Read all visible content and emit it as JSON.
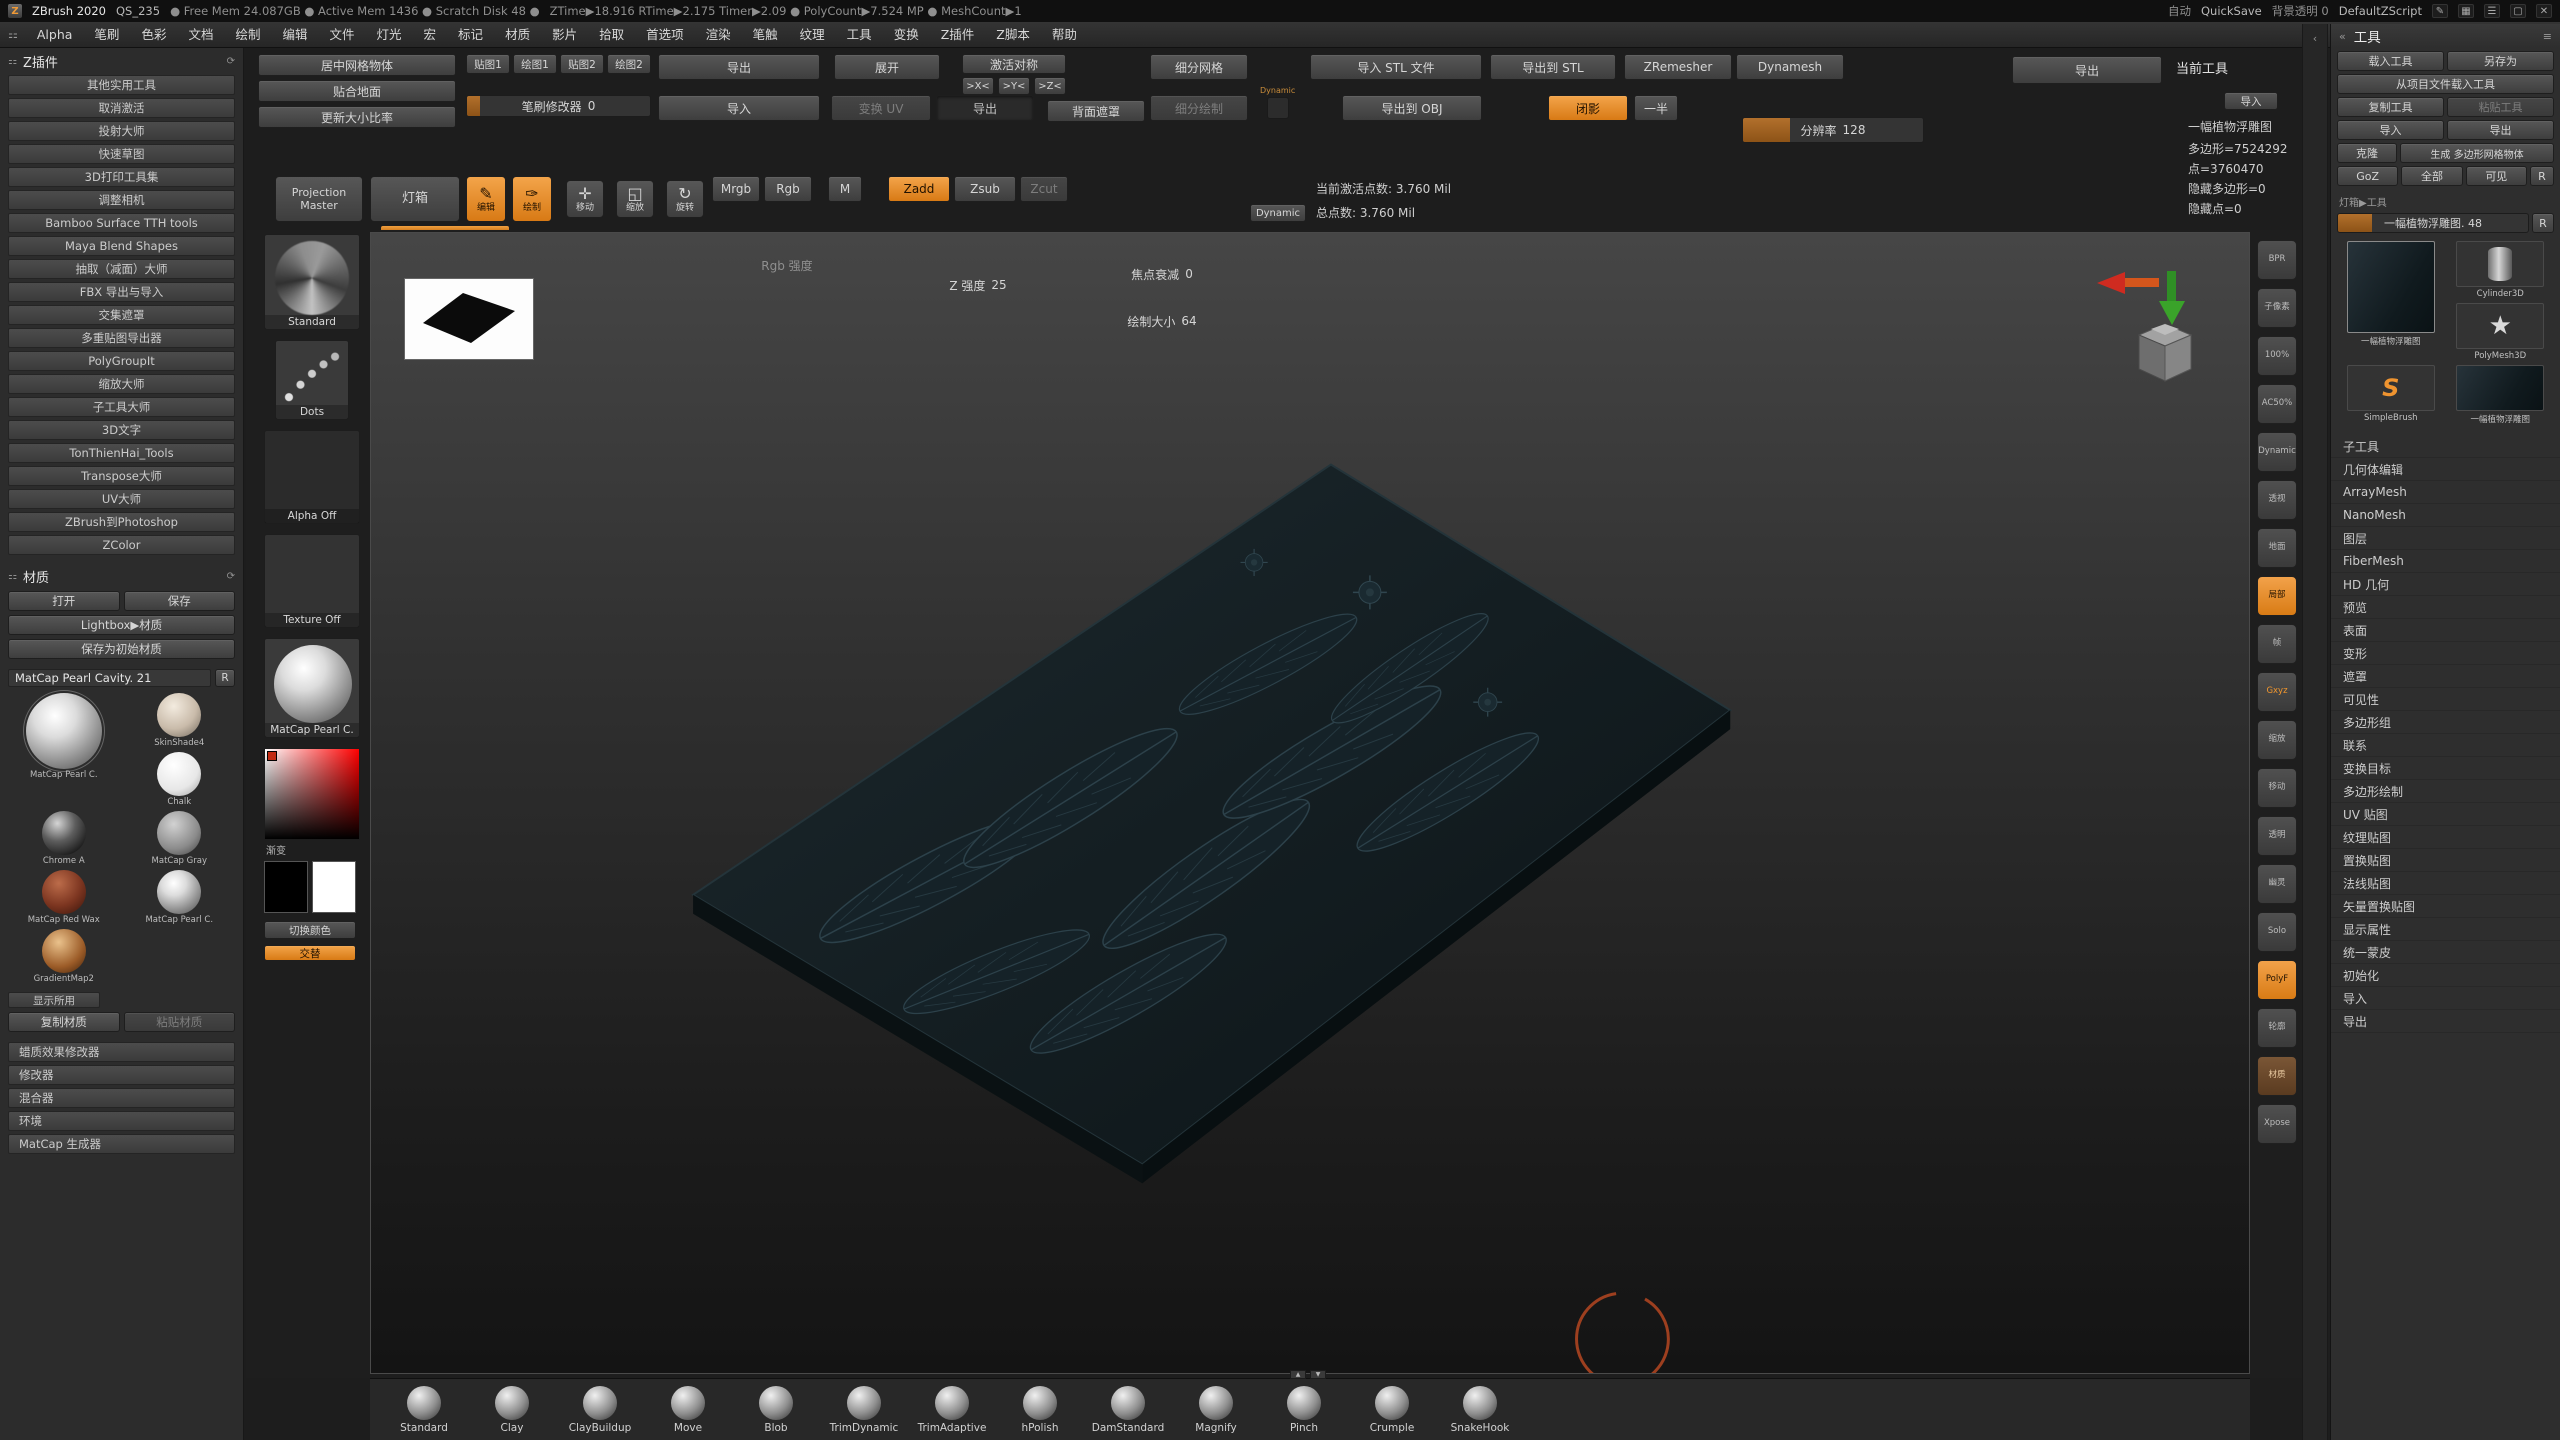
{
  "titlebar": {
    "logo": "Z",
    "app": "ZBrush 2020",
    "doc": "QS_235",
    "mem": "● Free Mem 24.087GB ● Active Mem 1436 ● Scratch Disk 48 ●",
    "time": "ZTime▶18.916 RTime▶2.175 Timer▶2.09 ● PolyCount▶7.524 MP ● MeshCount▶1",
    "auto": "自动",
    "quicksave": "QuickSave",
    "bg": "背景透明 0",
    "zscript": "DefaultZScript",
    "icons": {
      "pencil": "✎",
      "grid": "▦",
      "list": "☰",
      "window": "▢",
      "close": "✕"
    }
  },
  "menubar": {
    "left_icon": "⚏",
    "collapse": "«",
    "items": [
      "Alpha",
      "笔刷",
      "色彩",
      "文档",
      "绘制",
      "编辑",
      "文件",
      "灯光",
      "宏",
      "标记",
      "材质",
      "影片",
      "拾取",
      "首选项",
      "渲染",
      "笔触",
      "纹理",
      "工具",
      "变换",
      "Z插件",
      "Z脚本",
      "帮助"
    ]
  },
  "shelf": {
    "center_mesh": "居中网格物体",
    "snap_ground": "贴合地面",
    "update_ratio": "更新大小比率",
    "tex1": "贴图1",
    "paint1": "绘图1",
    "tex2": "贴图2",
    "paint2": "绘图2",
    "brush_mod": "笔刷修改器",
    "brush_mod_val": "0",
    "export1": "导出",
    "import1": "导入",
    "unwrap": "展开",
    "morph_uv": "变换 UV",
    "export2": "导出",
    "sym_active": "激活对称",
    "sx": ">X<",
    "sy": ">Y<",
    "sz": ">Z<",
    "backface": "背面遮罩",
    "divide": "细分网格",
    "divide_paint": "细分绘制",
    "dynamic_chip": "Dynamic",
    "import_stl": "导入 STL 文件",
    "export_obj": "导出到 OBJ",
    "export_stl": "导出到 STL",
    "shadow": "闭影",
    "half": "一半",
    "zremesher": "ZRemesher",
    "dynamesh": "Dynamesh",
    "resolution": "分辨率",
    "resolution_val": "128",
    "export_right": "导出",
    "current_tool": "当前工具",
    "import_small": "导入",
    "stats": {
      "name": "一幅植物浮雕图",
      "polys": "多边形=7524292",
      "points": "点=3760470",
      "hidden_polys": "隐藏多边形=0",
      "hidden_points": "隐藏点=0"
    }
  },
  "toolbar": {
    "projection_master_1": "Projection",
    "projection_master_2": "Master",
    "lightbox": "灯箱",
    "edit": "编辑",
    "draw": "绘制",
    "move": "移动",
    "scale": "缩放",
    "rotate": "旋转",
    "mrgb": "Mrgb",
    "rgb": "Rgb",
    "m": "M",
    "zadd": "Zadd",
    "zsub": "Zsub",
    "zcut": "Zcut",
    "rgb_intensity": "Rgb 强度",
    "z_intensity": "Z 强度",
    "z_intensity_val": "25",
    "focal": "焦点衰减",
    "focal_val": "0",
    "draw_size": "绘制大小",
    "draw_size_val": "64",
    "dynamic": "Dynamic",
    "active_points": "当前激活点数: 3.760 Mil",
    "total_points": "总点数: 3.760 Mil"
  },
  "zplugin": {
    "title": "Z插件",
    "refresh": "⟳",
    "items": [
      "其他实用工具",
      "取消激活",
      "投射大师",
      "快速草图",
      "3D打印工具集",
      "调整相机",
      "Bamboo Surface TTH tools",
      "Maya Blend Shapes",
      "抽取（减面）大师",
      "FBX 导出与导入",
      "交集遮罩",
      "多重贴图导出器",
      "PolyGroupIt",
      "缩放大师",
      "子工具大师",
      "3D文字",
      "TonThienHai_Tools",
      "Transpose大师",
      "UV大师",
      "ZBrush到Photoshop",
      "ZColor"
    ]
  },
  "material": {
    "title": "材质",
    "refresh": "⟳",
    "open": "打开",
    "save": "保存",
    "lightbox_mat": "Lightbox▶材质",
    "save_startup": "保存为初始材质",
    "current": "MatCap Pearl Cavity. 21",
    "r": "R",
    "spheres": [
      {
        "name": "MatCap Pearl C.",
        "cls": "sph-pearl",
        "cell": "big"
      },
      {
        "name": "SkinShade4",
        "cls": "sph-skin",
        "cell": ""
      },
      {
        "name": "Chalk",
        "cls": "sph-chalk",
        "cell": ""
      },
      {
        "name": "Chrome A",
        "cls": "sph-chrome",
        "cell": ""
      },
      {
        "name": "MatCap Gray",
        "cls": "sph-gray",
        "cell": ""
      },
      {
        "name": "MatCap Red Wax",
        "cls": "sph-redwax",
        "cell": ""
      },
      {
        "name": "MatCap Pearl C.",
        "cls": "sph-pearl",
        "cell": ""
      },
      {
        "name": "GradientMap2",
        "cls": "sph-gradient",
        "cell": ""
      }
    ],
    "show_used": "显示所用",
    "copy": "复制材质",
    "paste": "粘贴材质",
    "sections": [
      "蜡质效果修改器",
      "修改器",
      "混合器",
      "环境",
      "MatCap 生成器"
    ]
  },
  "strip": {
    "brush_label": "Standard",
    "stroke_label": "Dots",
    "alpha_label": "Alpha Off",
    "texture_label": "Texture Off",
    "material_label": "MatCap Pearl C.",
    "gradient_label": "渐变",
    "switch_color": "切换颜色",
    "swap": "交替"
  },
  "rightshelf": [
    {
      "label": "BPR",
      "cls": ""
    },
    {
      "label": "子像素",
      "cls": ""
    },
    {
      "label": "100%",
      "cls": ""
    },
    {
      "label": "AC50%",
      "cls": ""
    },
    {
      "label": "Dynamic",
      "cls": ""
    },
    {
      "label": "透视",
      "cls": ""
    },
    {
      "label": "地面",
      "cls": ""
    },
    {
      "label": "局部",
      "cls": "on"
    },
    {
      "label": "帧",
      "cls": ""
    },
    {
      "label": "Gxyz",
      "cls": "txt-on"
    },
    {
      "label": "缩放",
      "cls": ""
    },
    {
      "label": "移动",
      "cls": ""
    },
    {
      "label": "透明",
      "cls": ""
    },
    {
      "label": "幽灵",
      "cls": ""
    },
    {
      "label": "Solo",
      "cls": ""
    },
    {
      "label": "PolyF",
      "cls": "on"
    },
    {
      "label": "轮廓",
      "cls": ""
    },
    {
      "label": "材质",
      "cls": "warm"
    },
    {
      "label": "Xpose",
      "cls": ""
    }
  ],
  "toolpanel": {
    "title": "工具",
    "collapse": "«",
    "menu_icon": "≡",
    "load": "载入工具",
    "save_as": "另存为",
    "load_project": "从项目文件载入工具",
    "copy": "复制工具",
    "paste": "粘贴工具",
    "import": "导入",
    "export": "导出",
    "clone": "克隆",
    "make_polymesh": "生成 多边形网格物体",
    "goz": "GoZ",
    "all": "全部",
    "visible": "可见",
    "r": "R",
    "lightbox_tool": "灯箱▶工具",
    "active_slider": "一幅植物浮雕图. 48",
    "r2": "R",
    "tools": [
      {
        "name": "一幅植物浮雕图",
        "thumb": "thumb-relief",
        "cell": "big"
      },
      {
        "name": "Cylinder3D",
        "thumb": "thumb-cyl",
        "cell": ""
      },
      {
        "name": "PolyMesh3D",
        "thumb": "thumb-star",
        "cell": ""
      },
      {
        "name": "SimpleBrush",
        "thumb": "thumb-s",
        "cell": ""
      },
      {
        "name": "一幅植物浮雕图",
        "thumb": "thumb-relief",
        "cell": ""
      }
    ],
    "sections": [
      "子工具",
      "几何体编辑",
      "ArrayMesh",
      "NanoMesh",
      "图层",
      "FiberMesh",
      "HD 几何",
      "预览",
      "表面",
      "变形",
      "遮罩",
      "可见性",
      "多边形组",
      "联系",
      "变换目标",
      "多边形绘制",
      "UV 贴图",
      "纹理贴图",
      "置换贴图",
      "法线贴图",
      "矢量置换贴图",
      "显示属性",
      "统一蒙皮",
      "初始化",
      "导入",
      "导出"
    ]
  },
  "tray": {
    "up": "▲",
    "down": "▼",
    "brushes": [
      "Standard",
      "Clay",
      "ClayBuildup",
      "Move",
      "Blob",
      "TrimDynamic",
      "TrimAdaptive",
      "hPolish",
      "DamStandard",
      "Magnify",
      "Pinch",
      "Crumple",
      "SnakeHook"
    ]
  },
  "accent_color": "#e8872a"
}
